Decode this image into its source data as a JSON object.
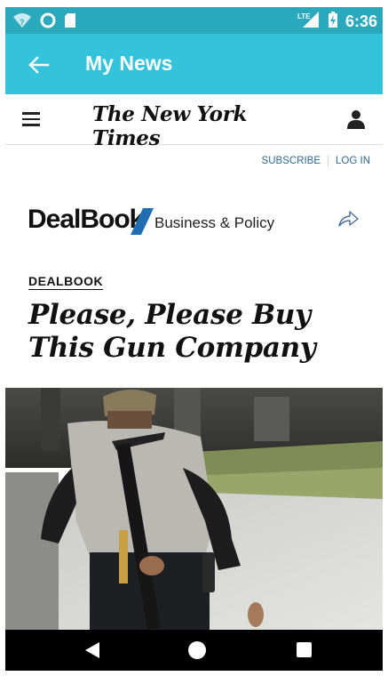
{
  "status_bar": {
    "time": "6:36",
    "network": "LTE",
    "icons": [
      "wifi-question-icon",
      "circle-icon",
      "sd-card-icon",
      "lte-signal-icon",
      "battery-charging-icon"
    ]
  },
  "app_bar": {
    "title": "My News",
    "back_icon": "arrow-left-icon"
  },
  "nyt_header": {
    "logo": "The New York Times",
    "menu_icon": "hamburger-menu-icon",
    "account_icon": "account-icon"
  },
  "links": {
    "subscribe": "SUBSCRIBE",
    "login": "LOG IN"
  },
  "section_brand": {
    "name": "DealBook",
    "subtitle": "Business & Policy",
    "share_icon": "share-icon"
  },
  "article": {
    "kicker": "DEALBOOK",
    "headline": "Please, Please Buy This Gun Company"
  },
  "nav_bar": {
    "icons": [
      "back-triangle-icon",
      "home-circle-icon",
      "recents-square-icon"
    ]
  },
  "colors": {
    "status_bar": "#2aa9bd",
    "app_bar": "#33c3da",
    "link_blue": "#326891",
    "dealbook_slash": "#1f6fb2"
  }
}
